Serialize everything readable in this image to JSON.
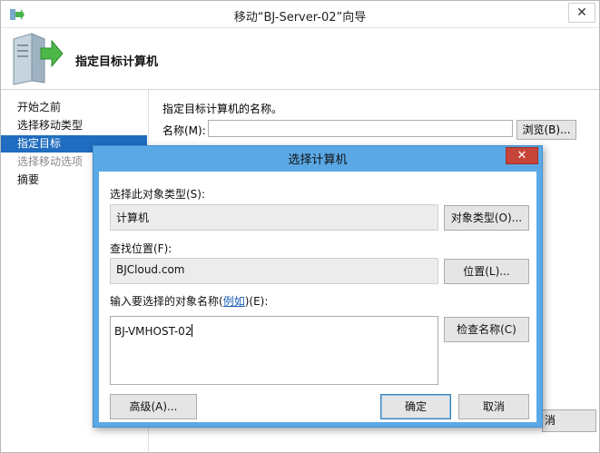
{
  "wizard": {
    "title": "移动“BJ-Server-02”向导",
    "close_glyph": "✕",
    "header_title": "指定目标计算机",
    "nav": [
      {
        "label": "开始之前",
        "state": "normal"
      },
      {
        "label": "选择移动类型",
        "state": "normal"
      },
      {
        "label": "指定目标",
        "state": "active"
      },
      {
        "label": "选择移动选项",
        "state": "disabled"
      },
      {
        "label": "摘要",
        "state": "normal"
      }
    ],
    "content_desc": "指定目标计算机的名称。",
    "name_label": "名称(M):",
    "name_value": "",
    "browse_label": "浏览(B)...",
    "partial_bottom_button": "消"
  },
  "dialog": {
    "title": "选择计算机",
    "close_glyph": "✕",
    "object_type_label": "选择此对象类型(S):",
    "object_type_value": "计算机",
    "object_type_button": "对象类型(O)...",
    "location_label": "查找位置(F):",
    "location_value": "BJCloud.com",
    "location_button": "位置(L)...",
    "names_label_prefix": "输入要选择的对象名称(",
    "names_label_link": "例如",
    "names_label_suffix": ")(E):",
    "names_value": "BJ-VMHOST-02",
    "check_names_button": "检查名称(C)",
    "advanced_button": "高级(A)...",
    "ok_button": "确定",
    "cancel_button": "取消"
  },
  "colors": {
    "dialog_frame": "#5aa9e6",
    "close_red": "#c7443a",
    "nav_active": "#1f6cc0",
    "link": "#1a5fb4"
  }
}
